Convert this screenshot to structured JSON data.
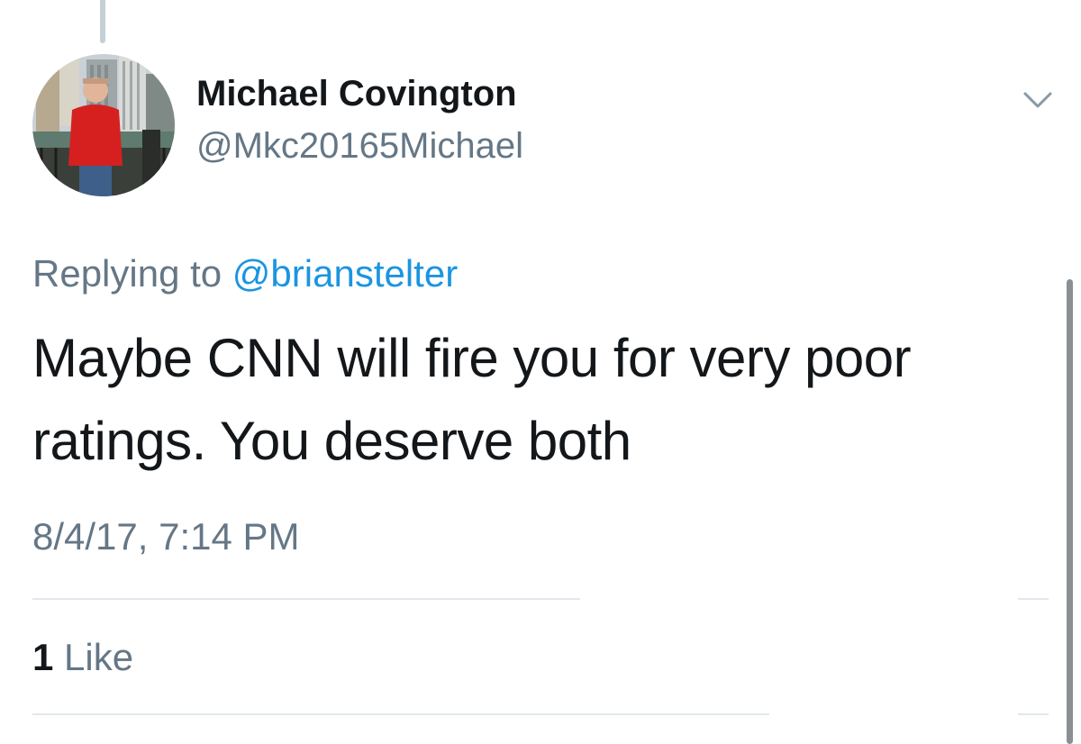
{
  "tweet": {
    "author": {
      "display_name": "Michael Covington",
      "handle": "@Mkc20165Michael",
      "avatar_icon": "profile-photo"
    },
    "menu_icon": "chevron-down-icon",
    "replying_prefix": "Replying to",
    "replying_to": "@brianstelter",
    "text": "Maybe CNN will fire you for very poor ratings. You deserve both",
    "timestamp": "8/4/17, 7:14 PM",
    "likes": {
      "count": "1",
      "label": "Like"
    }
  },
  "colors": {
    "primary_text": "#14171a",
    "secondary_text": "#657786",
    "link": "#1b95e0",
    "divider": "#e1e8ed",
    "thread_line": "#c4cfd6"
  }
}
